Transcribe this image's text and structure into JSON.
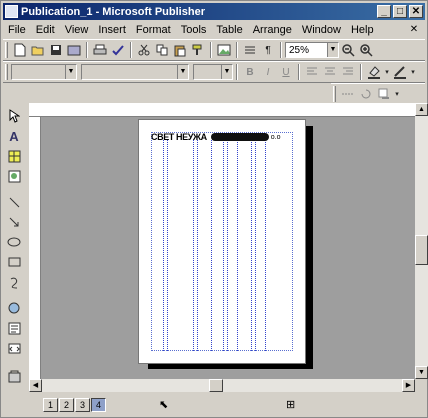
{
  "window": {
    "title": "Publication_1 - Microsoft Publisher",
    "controls": [
      "_",
      "□",
      "✕"
    ]
  },
  "menu": {
    "items": [
      "File",
      "Edit",
      "View",
      "Insert",
      "Format",
      "Tools",
      "Table",
      "Arrange",
      "Window",
      "Help"
    ],
    "close_doc": "✕"
  },
  "standard_toolbar": {
    "zoom_value": "25%"
  },
  "formatting_toolbar": {
    "style_value": "",
    "font_value": "",
    "size_value": "",
    "bold": "B",
    "italic": "I",
    "underline": "U"
  },
  "document": {
    "heading_text": "СВЕТ НЕУЖА",
    "heading_tail": "o.o"
  },
  "status": {
    "pages": [
      "1",
      "2",
      "3",
      "4"
    ],
    "active_page": "4"
  }
}
